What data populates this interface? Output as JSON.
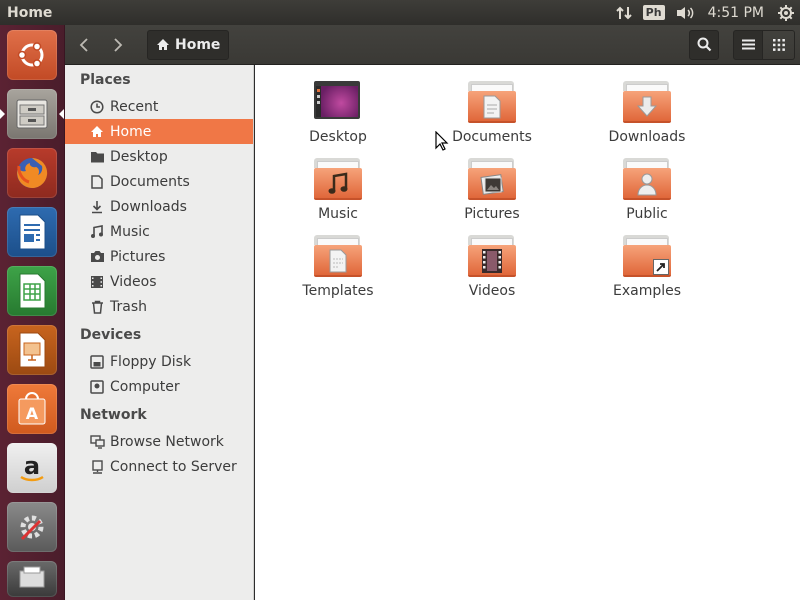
{
  "window": {
    "title": "Home"
  },
  "top_panel": {
    "keyboard_indicator": "Ph",
    "clock": "4:51 PM"
  },
  "header": {
    "path": "Home"
  },
  "sidebar": {
    "places_heading": "Places",
    "places": [
      {
        "label": "Recent",
        "icon": "clock-icon"
      },
      {
        "label": "Home",
        "icon": "home-icon",
        "active": true
      },
      {
        "label": "Desktop",
        "icon": "folder-icon"
      },
      {
        "label": "Documents",
        "icon": "document-icon"
      },
      {
        "label": "Downloads",
        "icon": "download-icon"
      },
      {
        "label": "Music",
        "icon": "music-icon"
      },
      {
        "label": "Pictures",
        "icon": "camera-icon"
      },
      {
        "label": "Videos",
        "icon": "film-icon"
      },
      {
        "label": "Trash",
        "icon": "trash-icon"
      }
    ],
    "devices_heading": "Devices",
    "devices": [
      {
        "label": "Floppy Disk",
        "icon": "floppy-icon"
      },
      {
        "label": "Computer",
        "icon": "drive-icon"
      }
    ],
    "network_heading": "Network",
    "network": [
      {
        "label": "Browse Network",
        "icon": "network-icon"
      },
      {
        "label": "Connect to Server",
        "icon": "server-icon"
      }
    ]
  },
  "files": [
    {
      "label": "Desktop",
      "icon": "desktop-folder-icon"
    },
    {
      "label": "Documents",
      "icon": "documents-folder-icon"
    },
    {
      "label": "Downloads",
      "icon": "downloads-folder-icon"
    },
    {
      "label": "Music",
      "icon": "music-folder-icon"
    },
    {
      "label": "Pictures",
      "icon": "pictures-folder-icon"
    },
    {
      "label": "Public",
      "icon": "public-folder-icon"
    },
    {
      "label": "Templates",
      "icon": "templates-folder-icon"
    },
    {
      "label": "Videos",
      "icon": "videos-folder-icon"
    },
    {
      "label": "Examples",
      "icon": "examples-folder-icon"
    }
  ],
  "colors": {
    "accent": "#f07746",
    "launcher": "#5b2233",
    "folder": "#e0673a"
  }
}
